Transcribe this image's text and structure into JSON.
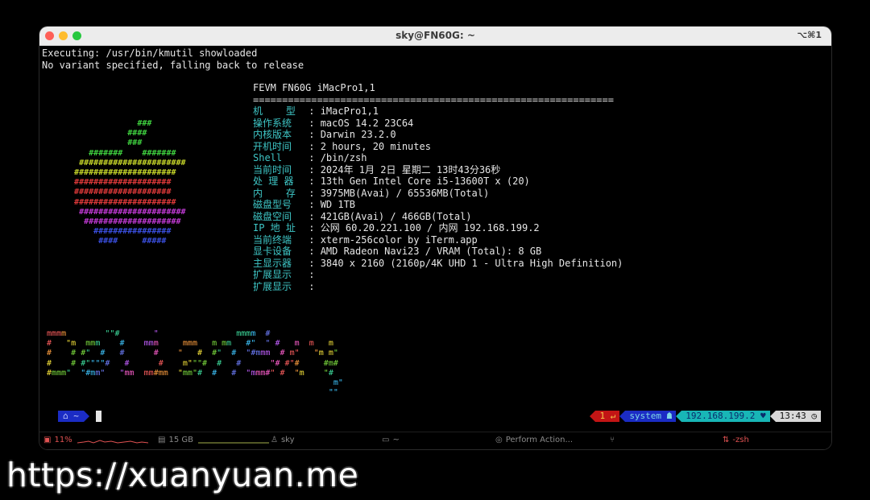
{
  "window": {
    "title": "sky@FN60G: ~",
    "shortcut": "⌥⌘1"
  },
  "terminal": {
    "lines": [
      "Executing: /usr/bin/kmutil showloaded",
      "No variant specified, falling back to release"
    ]
  },
  "sysinfo": {
    "header": "FEVM FN60G iMacPro1,1",
    "divider": "==============================================================",
    "rows": [
      {
        "key": "机    型",
        "value": "iMacPro1,1"
      },
      {
        "key": "操作系统",
        "value": "macOS 14.2 23C64"
      },
      {
        "key": "内核版本",
        "value": "Darwin 23.2.0"
      },
      {
        "key": "开机时间",
        "value": "2 hours, 20 minutes"
      },
      {
        "key": "Shell   ",
        "value": "/bin/zsh"
      },
      {
        "key": "当前时间",
        "value": "2024年 1月 2日 星期二 13时43分36秒"
      },
      {
        "key": "处 理 器",
        "value": "13th Gen Intel Core i5-13600T x (20)"
      },
      {
        "key": "内    存",
        "value": "3975MB(Avai) / 65536MB(Total)"
      },
      {
        "key": "磁盘型号",
        "value": "WD 1TB"
      },
      {
        "key": "磁盘空间",
        "value": "421GB(Avai) / 466GB(Total)"
      },
      {
        "key": "IP 地 址",
        "value": "公网 60.20.221.100 / 内网 192.168.199.2"
      },
      {
        "key": "当前终端",
        "value": "xterm-256color by iTerm.app"
      },
      {
        "key": "显卡设备",
        "value": "AMD Radeon Navi23 / VRAM (Total): 8 GB"
      },
      {
        "key": "主显示器",
        "value": "3840 x 2160 (2160p/4K UHD 1 - Ultra High Definition)"
      },
      {
        "key": "扩展显示",
        "value": ""
      },
      {
        "key": "扩展显示",
        "value": ""
      }
    ]
  },
  "apple_logo_art": [
    {
      "text": "                ###",
      "color": "#3fd13f"
    },
    {
      "text": "              ####",
      "color": "#3fd13f"
    },
    {
      "text": "              ###",
      "color": "#3fd13f"
    },
    {
      "text": "      #######    #######",
      "color": "#3fd13f"
    },
    {
      "text": "    ######################",
      "color": "#c8d82a"
    },
    {
      "text": "   #####################",
      "color": "#c8d82a"
    },
    {
      "text": "   ####################",
      "color": "#e03a3a"
    },
    {
      "text": "   ####################",
      "color": "#e03a3a"
    },
    {
      "text": "   #####################",
      "color": "#e03a3a"
    },
    {
      "text": "    ######################",
      "color": "#c23ad6"
    },
    {
      "text": "     ####################",
      "color": "#c23ad6"
    },
    {
      "text": "       ################",
      "color": "#3a4fe0"
    },
    {
      "text": "        ####     #####",
      "color": "#3a4fe0"
    }
  ],
  "figlet_lines": [
    "mmmm        \"\"#       \"                mmmm  #",
    "#   \"m  mmm    #    mmm     mmm   m mm   #\"  \" #   m  m   m",
    "#    # #\"  #   #      #    \"   #  #\"  #  \"#mmm  # m\"   \"m m\"",
    "#    # #\"\"\"\"#   #      #    m\"\"\"#  #   #      \"# #\"#     #m#",
    "#mmm\"  \"#mm\"   \"mm  mm#mm  \"mm\"#  #   #  \"mmm#\" #  \"m    \"#",
    "                                                           m\"",
    "                                                          \"\""
  ],
  "prompt": {
    "left_icon": "apple-icon",
    "left_segment": "⌂ ~",
    "right_segments": [
      {
        "text": "1 ↵",
        "bg": "#c31515",
        "fg": "#f4c94b"
      },
      {
        "text": "system ☗",
        "bg": "#1b2cc4",
        "fg": "#7fd8e6"
      },
      {
        "text": "192.168.199.2 ♥",
        "bg": "#18b6b6",
        "fg": "#0a2b6b"
      },
      {
        "text": "13:43 ◷",
        "bg": "#d8d8d8",
        "fg": "#111111"
      }
    ]
  },
  "statusbar": {
    "cpu": "11%",
    "mem": "15 GB",
    "user": "sky",
    "dir": "~",
    "action": "Perform Action...",
    "branch_icon": "git-branch-icon",
    "job": "-zsh",
    "colors": {
      "cpu": "#e05252",
      "mem": "#a4b04b"
    }
  },
  "watermark": "https://xuanyuan.me"
}
